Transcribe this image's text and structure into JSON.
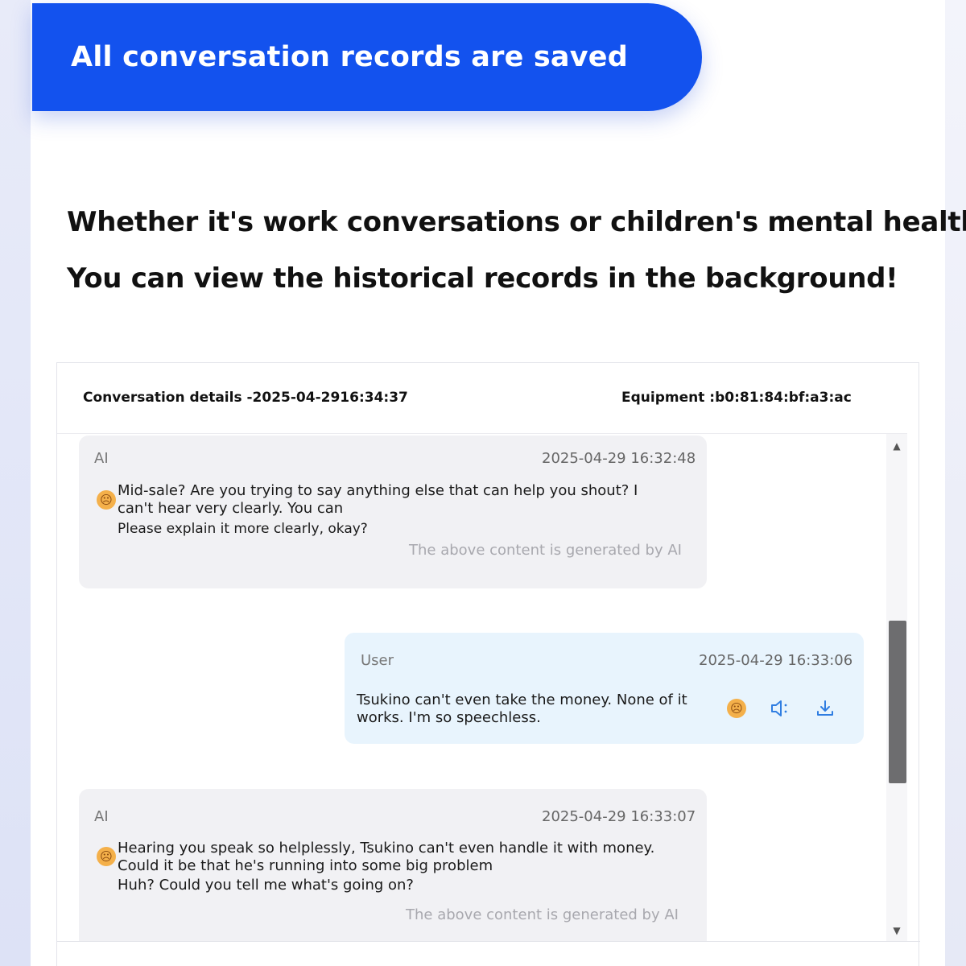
{
  "banner": {
    "text": "All conversation records are saved"
  },
  "headline": {
    "line1": "Whether it's work conversations or children's mental health,",
    "line2": "You can view the historical records in the background!"
  },
  "panel": {
    "title": "Conversation details -2025-04-2916:34:37",
    "equipment": "Equipment :b0:81:84:bf:a3:ac"
  },
  "messages": [
    {
      "role": "AI",
      "time": "2025-04-29 16:32:48",
      "emoji_icon": "worried-face-icon",
      "line1": "Mid-sale? Are you trying to say anything else that can help you shout? I",
      "line2": "can't hear very clearly. You can",
      "line3": "Please explain it more clearly, okay?",
      "note": "The above content is generated by AI"
    },
    {
      "role": "User",
      "time": "2025-04-29 16:33:06",
      "line1": "Tsukino can't even take the money. None of it",
      "line2": "works. I'm so speechless.",
      "emoji_icon": "sad-face-icon",
      "actions": [
        "sad-face-icon",
        "speaker-icon",
        "download-icon"
      ]
    },
    {
      "role": "AI",
      "time": "2025-04-29 16:33:07",
      "emoji_icon": "sad-face-icon",
      "line1": "Hearing you speak so helplessly, Tsukino can't even handle it with money.",
      "line2": "Could it be that he's running into some big problem",
      "line3": "Huh? Could you tell me what's going on?",
      "note": "The above content is generated by AI"
    }
  ],
  "colors": {
    "banner": "#1352ee",
    "ai_bubble": "#f1f1f4",
    "user_bubble": "#e8f4fd",
    "icon_accent": "#2f7de1"
  }
}
